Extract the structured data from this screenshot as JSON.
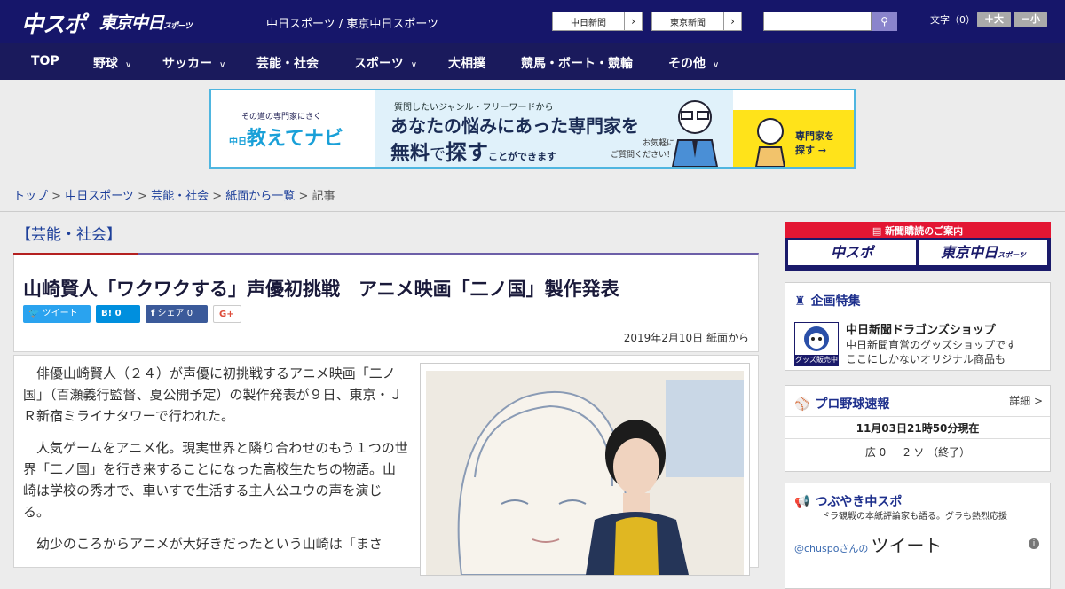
{
  "header": {
    "logo_chuspo": "中スポ",
    "logo_tokyo": "東京中日",
    "logo_tokyo_small": "スポーツ",
    "site_title": "中日スポーツ / 東京中日スポーツ",
    "paper_links": [
      {
        "label": "中日新聞",
        "icon": "chevron-right-icon"
      },
      {
        "label": "東京新聞",
        "icon": "chevron-right-icon"
      }
    ],
    "search_placeholder": "",
    "search_icon": "search-icon",
    "font_size_label": "文字（0）",
    "font_larger": "＋大",
    "font_smaller": "－小"
  },
  "nav": {
    "items": [
      {
        "label": "TOP",
        "dropdown": false
      },
      {
        "label": "野球",
        "dropdown": true
      },
      {
        "label": "サッカー",
        "dropdown": true
      },
      {
        "label": "芸能・社会",
        "dropdown": false
      },
      {
        "label": "スポーツ",
        "dropdown": true
      },
      {
        "label": "大相撲",
        "dropdown": false
      },
      {
        "label": "競馬・ボート・競輪",
        "dropdown": false
      },
      {
        "label": "その他",
        "dropdown": true
      }
    ]
  },
  "ad": {
    "left_tag": "その道の専門家にきく",
    "left_logo": "教えてナビ",
    "left_logo_small": "中日",
    "line1": "質問したいジャンル・フリーワードから",
    "line2": "あなたの悩みにあった専門家を",
    "line3a": "無料",
    "line3b": "で",
    "line3c": "探す",
    "line3d": "ことができます",
    "note": "お気軽に\nご質問ください！",
    "cta": "専門家を\n探す →"
  },
  "breadcrumb": {
    "items": [
      "トップ",
      "中日スポーツ",
      "芸能・社会",
      "紙面から一覧"
    ],
    "current": "記事"
  },
  "article": {
    "category": "【芸能・社会】",
    "title": "山崎賢人「ワクワクする」声優初挑戦　アニメ映画「二ノ国」製作発表",
    "share": {
      "twitter": "ツイート",
      "hatena": "B! 0",
      "facebook": "シェア 0",
      "gplus": "G+"
    },
    "date": "2019年2月10日 紙面から",
    "paragraphs": [
      "俳優山崎賢人（２４）が声優に初挑戦するアニメ映画「二ノ国」（百瀬義行監督、夏公開予定）の製作発表が９日、東京・ＪＲ新宿ミライナタワーで行われた。",
      "人気ゲームをアニメ化。現実世界と隣り合わせのもう１つの世界「二ノ国」を行き来することになった高校生たちの物語。山崎は学校の秀才で、車いすで生活する主人公ユウの声を演じる。",
      "幼少のころからアニメが大好きだったという山崎は「まさ"
    ]
  },
  "sidebar": {
    "subscribe_heading": "新聞購読のご案内",
    "subscribe_chuspo": "中スポ",
    "subscribe_tokyo": "東京中日",
    "subscribe_tokyo_small": "スポーツ",
    "feature": {
      "heading": "企画特集",
      "title": "中日新聞ドラゴンズショップ",
      "desc1": "中日新聞直営のグッズショップです",
      "desc2": "ここにしかないオリジナル商品も",
      "badge": "グッズ販売中"
    },
    "baseball": {
      "heading": "プロ野球速報",
      "more": "詳細 >",
      "time": "11月03日21時50分現在",
      "score": "広 0 － 2 ソ （終了）"
    },
    "tweets": {
      "heading": "つぶやき中スポ",
      "sub": "ドラ観戦の本紙評論家も語る。グラも熱烈応援",
      "handle": "@chuspoさんの",
      "label": "ツイート",
      "info": "i"
    }
  },
  "colors": {
    "header_bg": "#16166a",
    "nav_bg": "#1a1a5c",
    "accent_red": "#e31633",
    "link": "#1d3f9a"
  }
}
